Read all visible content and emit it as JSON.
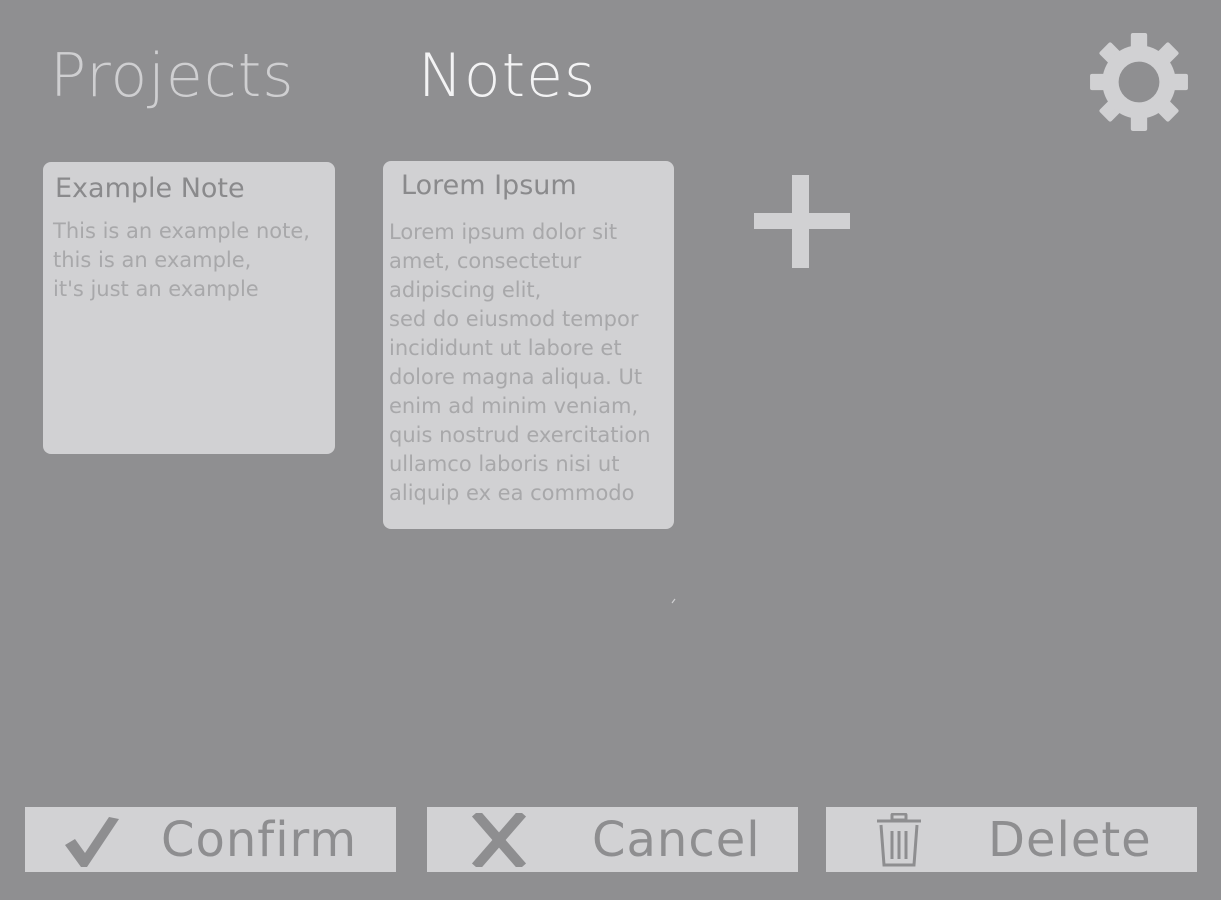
{
  "header": {
    "tabs": [
      {
        "label": "Projects",
        "active": false
      },
      {
        "label": "Notes",
        "active": true
      }
    ],
    "settings_icon": "gear-icon"
  },
  "notes": [
    {
      "title": "Example Note",
      "body": "This is an example note,\nthis is an example,\nit's just an example"
    },
    {
      "title": "Lorem Ipsum",
      "body": "Lorem ipsum dolor sit\namet, consectetur\nadipiscing elit,\nsed do eiusmod tempor\nincididunt ut labore et\ndolore magna aliqua. Ut\nenim ad minim veniam,\nquis nostrud exercitation\nullamco laboris nisi ut\naliquip ex ea commodo"
    }
  ],
  "add_note_icon": "plus-icon",
  "actions": {
    "confirm": {
      "label": "Confirm",
      "icon": "checkmark-icon"
    },
    "cancel": {
      "label": "Cancel",
      "icon": "x-icon"
    },
    "delete": {
      "label": "Delete",
      "icon": "trash-icon"
    }
  },
  "colors": {
    "background": "#8f8f91",
    "card": "#d1d1d3",
    "button": "#d2d2d4",
    "active_tab": "#f3f3f4",
    "inactive_tab": "#cfcfd1"
  }
}
